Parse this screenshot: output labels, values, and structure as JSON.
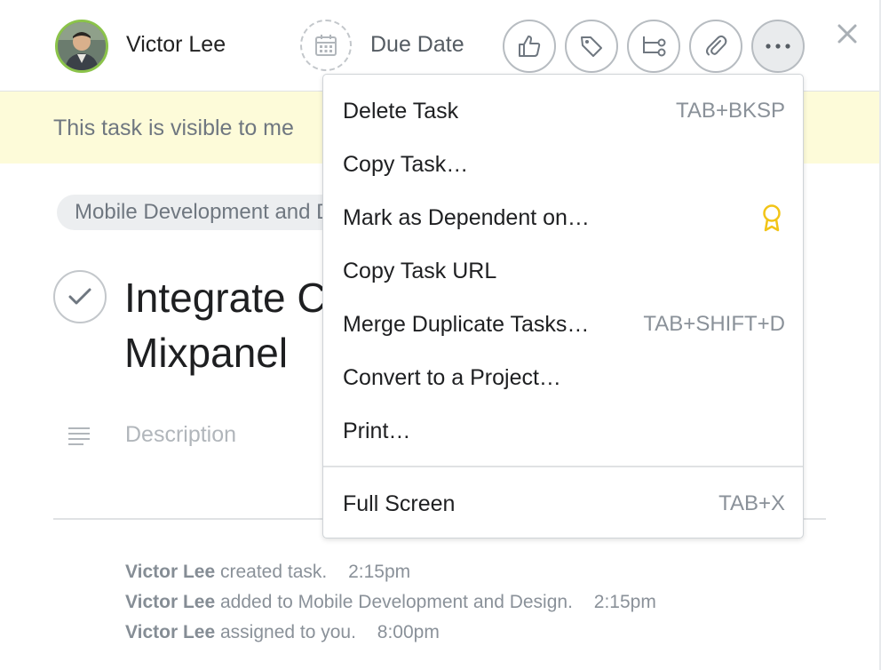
{
  "header": {
    "assignee_name": "Victor Lee",
    "due_date_label": "Due Date"
  },
  "banner": {
    "text": "This task is visible to me"
  },
  "task": {
    "project_tag": "Mobile Development and Design",
    "title_line1": "Integrate Countly with",
    "title_line2": "Mixpanel",
    "description_placeholder": "Description"
  },
  "stories": [
    {
      "actor": "Victor Lee",
      "action": "created task.",
      "time": "2:15pm"
    },
    {
      "actor": "Victor Lee",
      "action": "added to Mobile Development and Design.",
      "time": "2:15pm"
    },
    {
      "actor": "Victor Lee",
      "action": "assigned to you.",
      "time": "8:00pm"
    }
  ],
  "menu": {
    "items": [
      {
        "label": "Delete Task",
        "shortcut": "TAB+BKSP"
      },
      {
        "label": "Copy Task…",
        "shortcut": ""
      },
      {
        "label": "Mark as Dependent on…",
        "shortcut": ""
      },
      {
        "label": "Copy Task URL",
        "shortcut": ""
      },
      {
        "label": "Merge Duplicate Tasks…",
        "shortcut": "TAB+SHIFT+D"
      },
      {
        "label": "Convert to a Project…",
        "shortcut": ""
      },
      {
        "label": "Print…",
        "shortcut": ""
      }
    ],
    "footer_item": {
      "label": "Full Screen",
      "shortcut": "TAB+X"
    }
  },
  "icons": {
    "avatar": "user-avatar",
    "due_date": "calendar-icon",
    "like": "thumbs-up-icon",
    "tags": "tag-icon",
    "subtasks": "subtasks-icon",
    "attachment": "paperclip-icon",
    "more": "more-icon",
    "close": "close-icon",
    "premium": "ribbon-badge-icon",
    "description": "text-lines-icon",
    "complete": "checkmark-icon"
  },
  "colors": {
    "banner_bg": "#fdfbd9",
    "avatar_ring": "#8bc34a",
    "premium_badge": "#f2c417"
  }
}
